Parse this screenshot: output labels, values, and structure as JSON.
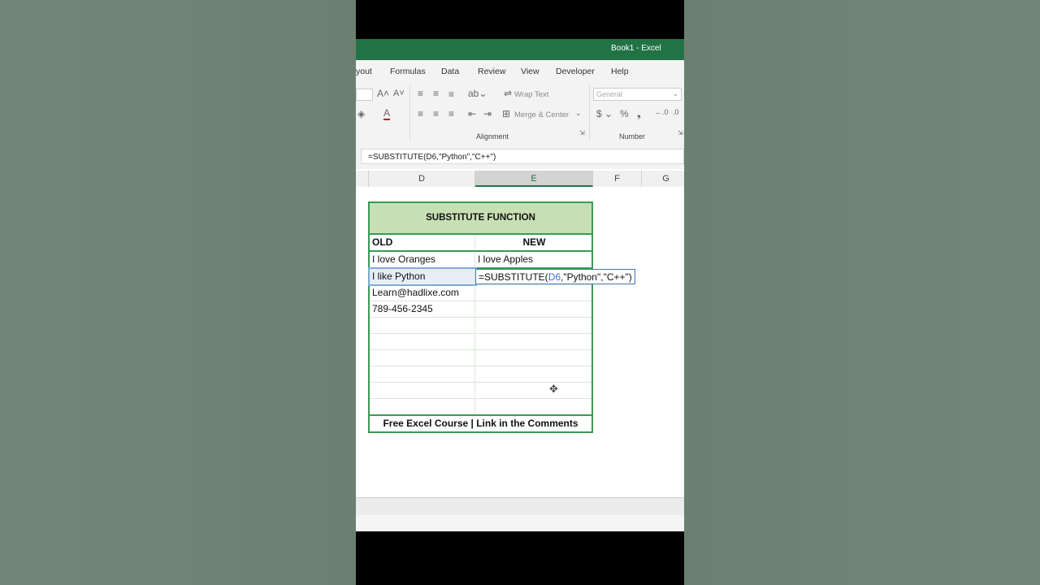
{
  "window": {
    "title": "Book1  -  Excel"
  },
  "tabs": [
    "yout",
    "Formulas",
    "Data",
    "Review",
    "View",
    "Developer",
    "Help"
  ],
  "ribbon": {
    "wrap_text": "Wrap Text",
    "merge_center": "Merge & Center",
    "number_format": "General",
    "alignment_label": "Alignment",
    "number_label": "Number"
  },
  "formula_bar": {
    "value": "=SUBSTITUTE(D6,\"Python\",\"C++\")"
  },
  "columns": [
    "D",
    "E",
    "F",
    "G"
  ],
  "table": {
    "title": "SUBSTITUTE FUNCTION",
    "col_old": "OLD",
    "col_new": "NEW",
    "rows": [
      {
        "old": "I love Oranges",
        "new": "I love Apples"
      },
      {
        "old": "I like Python",
        "new": ""
      },
      {
        "old": "Learn@hadlixe.com",
        "new": ""
      },
      {
        "old": "789-456-2345",
        "new": ""
      },
      {
        "old": "",
        "new": ""
      },
      {
        "old": "",
        "new": ""
      },
      {
        "old": "",
        "new": ""
      },
      {
        "old": "",
        "new": ""
      },
      {
        "old": "",
        "new": ""
      },
      {
        "old": "",
        "new": ""
      }
    ],
    "editing": {
      "prefix": "=SUBSTITUTE(",
      "ref": "D6",
      "suffix": ",\"Python\",\"C++\")"
    },
    "footer": "Free Excel Course | Link in the Comments"
  },
  "colors": {
    "excel_green": "#217346",
    "table_border": "#3a9a55",
    "header_fill": "#c6e0b4"
  }
}
